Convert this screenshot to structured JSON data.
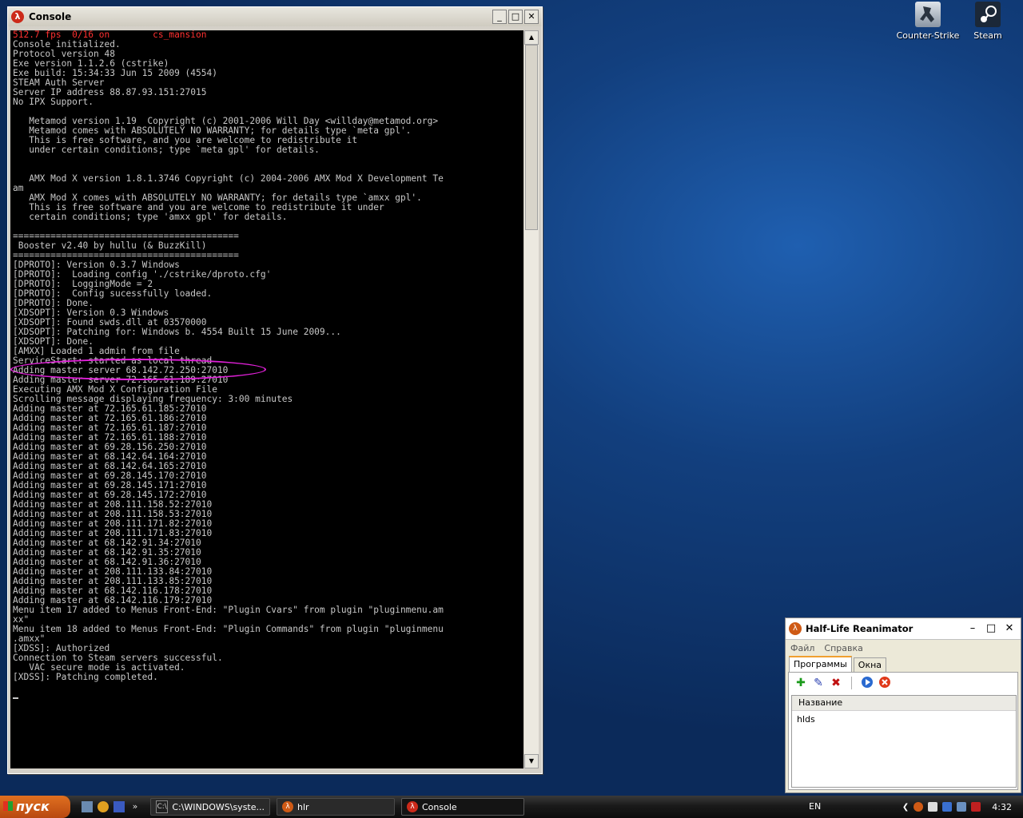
{
  "desktop": {
    "icons": [
      {
        "label": "Counter-Strike"
      },
      {
        "label": "Steam"
      }
    ]
  },
  "console_window": {
    "title": "Console",
    "status_line": "512.7 fps  0/16 on        cs_mansion",
    "lines": [
      "Console initialized.",
      "Protocol version 48",
      "Exe version 1.1.2.6 (cstrike)",
      "Exe build: 15:34:33 Jun 15 2009 (4554)",
      "STEAM Auth Server",
      "Server IP address 88.87.93.151:27015",
      "No IPX Support.",
      "",
      "   Metamod version 1.19  Copyright (c) 2001-2006 Will Day <willday@metamod.org>",
      "   Metamod comes with ABSOLUTELY NO WARRANTY; for details type `meta gpl'.",
      "   This is free software, and you are welcome to redistribute it",
      "   under certain conditions; type `meta gpl' for details.",
      "",
      "",
      "   AMX Mod X version 1.8.1.3746 Copyright (c) 2004-2006 AMX Mod X Development Te",
      "am",
      "   AMX Mod X comes with ABSOLUTELY NO WARRANTY; for details type `amxx gpl'.",
      "   This is free software and you are welcome to redistribute it under",
      "   certain conditions; type 'amxx gpl' for details.",
      "",
      "==========================================",
      " Booster v2.40 by hullu (& BuzzKill)",
      "==========================================",
      "[DPROTO]: Version 0.3.7 Windows",
      "[DPROTO]:  Loading config './cstrike/dproto.cfg'",
      "[DPROTO]:  LoggingMode = 2",
      "[DPROTO]:  Config sucessfully loaded.",
      "[DPROTO]: Done.",
      "[XDSOPT]: Version 0.3 Windows",
      "[XDSOPT]: Found swds.dll at 03570000",
      "[XDSOPT]: Patching for: Windows b. 4554 Built 15 June 2009...",
      "[XDSOPT]: Done.",
      "[AMXX] Loaded 1 admin from file",
      "ServiceStart: started as local thread",
      "Adding master server 68.142.72.250:27010",
      "Adding master server 72.165.61.189:27010",
      "Executing AMX Mod X Configuration File",
      "Scrolling message displaying frequency: 3:00 minutes",
      "Adding master at 72.165.61.185:27010",
      "Adding master at 72.165.61.186:27010",
      "Adding master at 72.165.61.187:27010",
      "Adding master at 72.165.61.188:27010",
      "Adding master at 69.28.156.250:27010",
      "Adding master at 68.142.64.164:27010",
      "Adding master at 68.142.64.165:27010",
      "Adding master at 69.28.145.170:27010",
      "Adding master at 69.28.145.171:27010",
      "Adding master at 69.28.145.172:27010",
      "Adding master at 208.111.158.52:27010",
      "Adding master at 208.111.158.53:27010",
      "Adding master at 208.111.171.82:27010",
      "Adding master at 208.111.171.83:27010",
      "Adding master at 68.142.91.34:27010",
      "Adding master at 68.142.91.35:27010",
      "Adding master at 68.142.91.36:27010",
      "Adding master at 208.111.133.84:27010",
      "Adding master at 208.111.133.85:27010",
      "Adding master at 68.142.116.178:27010",
      "Adding master at 68.142.116.179:27010",
      "Menu item 17 added to Menus Front-End: \"Plugin Cvars\" from plugin \"pluginmenu.am",
      "xx\"",
      "Menu item 18 added to Menus Front-End: \"Plugin Commands\" from plugin \"pluginmenu",
      ".amxx\"",
      "[XDSS]: Authorized",
      "Connection to Steam servers successful.",
      "   VAC secure mode is activated.",
      "[XDSS]: Patching completed."
    ]
  },
  "hlr_window": {
    "title": "Half-Life Reanimator",
    "menu": [
      "Файл",
      "Справка"
    ],
    "tabs": [
      "Программы",
      "Окна"
    ],
    "list_header": "Название",
    "list_rows": [
      "hlds"
    ]
  },
  "taskbar": {
    "start_label": "пуск",
    "tasks": [
      {
        "label": "C:\\WINDOWS\\syste..."
      },
      {
        "label": "hlr"
      },
      {
        "label": "Console"
      }
    ],
    "language": "EN",
    "clock": "4:32"
  }
}
